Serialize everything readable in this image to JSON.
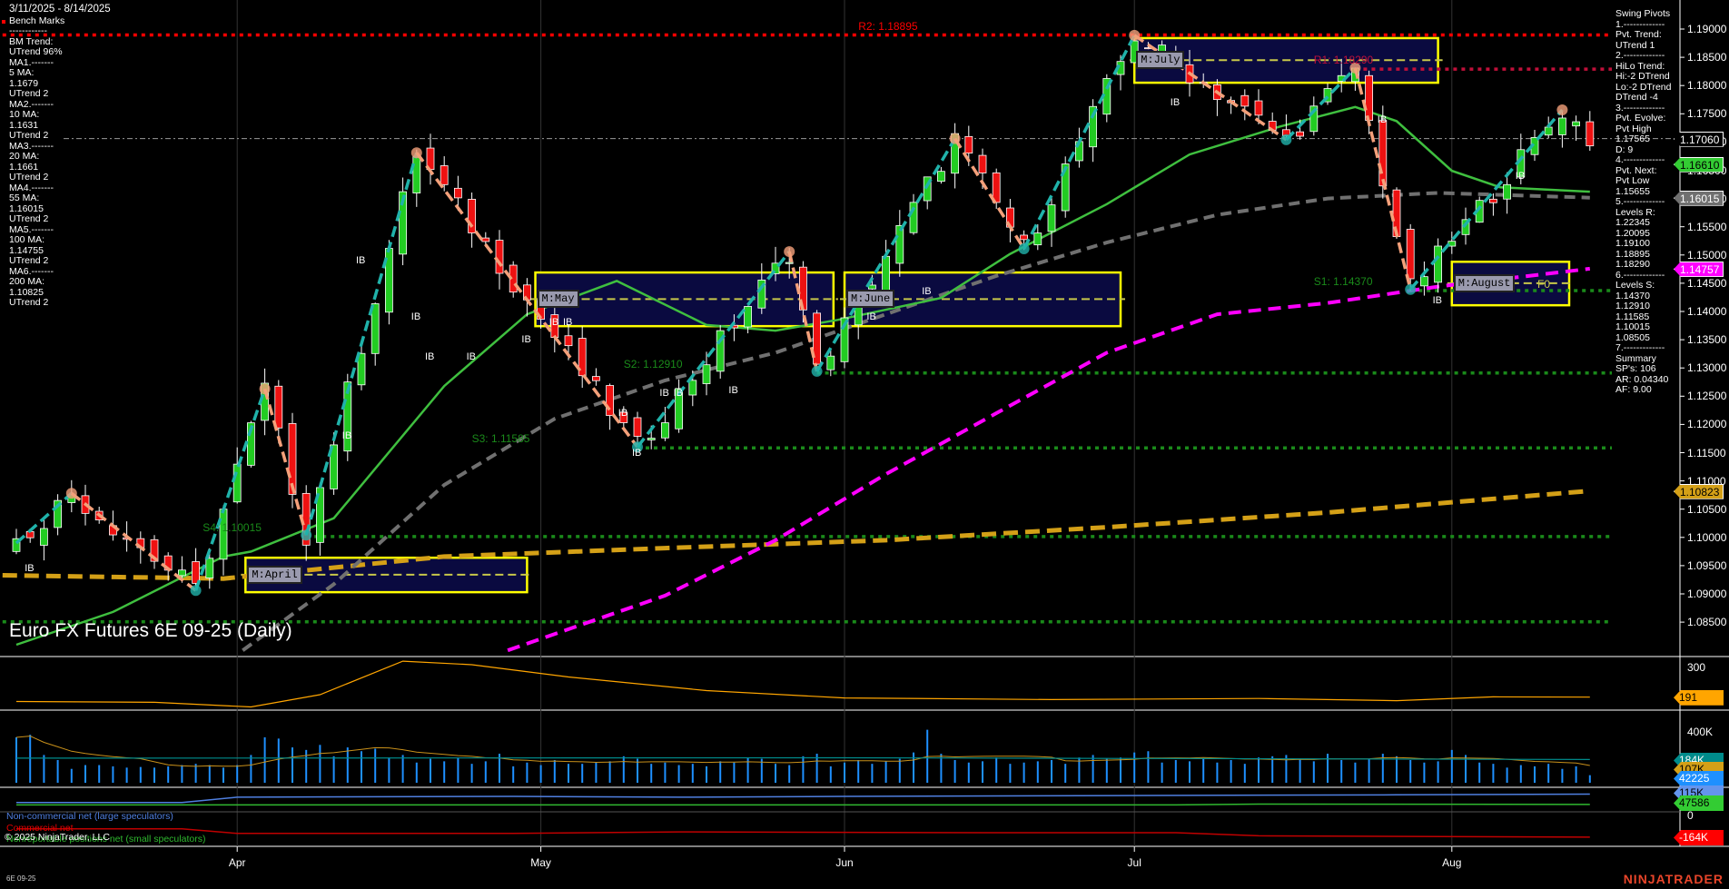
{
  "header": {
    "date_range": "3/11/2025 - 8/14/2025",
    "bench_marks": "Bench Marks"
  },
  "left_panel": [
    "------------",
    "BM Trend:",
    "UTrend 96%",
    "MA1.-------",
    "5 MA:",
    "1.1679",
    "UTrend 2",
    "MA2.-------",
    "10 MA:",
    "1.1631",
    "UTrend 2",
    "MA3.-------",
    "20 MA:",
    "1.1661",
    "UTrend 2",
    "MA4.-------",
    "55 MA:",
    "1.16015",
    "UTrend 2",
    "MA5.-------",
    "100 MA:",
    "1.14755",
    "UTrend 2",
    "MA6.-------",
    "200 MA:",
    "1.10825",
    "UTrend 2"
  ],
  "right_panel": [
    "Swing Pivots",
    "1.-------------",
    "Pvt. Trend:",
    "UTrend 1",
    "2.-------------",
    "HiLo Trend:",
    "Hi:-2 DTrend",
    "Lo:-2 DTrend",
    "DTrend -4",
    "3.-------------",
    "Pvt. Evolve:",
    "Pvt High",
    "1.17565",
    "D: 9",
    "4.-------------",
    "Pvt. Next:",
    "Pvt Low",
    "1.15655",
    "5.-------------",
    "Levels R:",
    "1.22345",
    "1.20095",
    "1.19100",
    "1.18895",
    "1.18290",
    "6.-------------",
    "Levels S:",
    "1.14370",
    "1.12910",
    "1.11585",
    "1.10015",
    "1.08505",
    "7.-------------",
    "Summary",
    "SP's: 106",
    "AR: 0.04340",
    "AF: 9.00"
  ],
  "title": "Euro FX Futures 6E 09-25 (Daily)",
  "symbol": "6E 09-25",
  "copyright": "© 2025 NinjaTrader, LLC",
  "brand": "NINJATRADER",
  "legend": [
    {
      "text": "Non-commercial net (large speculators)",
      "color": "#4f7fe0"
    },
    {
      "text": "Commercial net",
      "color": "#e00000"
    },
    {
      "text": "Nonreportable positions net (small speculators)",
      "color": "#2fb82f"
    }
  ],
  "chart_data": {
    "type": "candlestick",
    "title": "Euro FX Futures 6E 09-25 (Daily)",
    "ylim": [
      1.08,
      1.1925
    ],
    "y_ticks": [
      "1.19000",
      "1.18500",
      "1.18000",
      "1.17500",
      "1.17000",
      "1.16500",
      "1.16000",
      "1.15500",
      "1.15000",
      "1.14500",
      "1.14000",
      "1.13500",
      "1.13000",
      "1.12500",
      "1.12000",
      "1.11500",
      "1.11000",
      "1.10500",
      "1.10000",
      "1.09500",
      "1.09000",
      "1.08500"
    ],
    "bars": 115,
    "months": [
      {
        "label": "Apr",
        "bar": 16
      },
      {
        "label": "May",
        "bar": 38
      },
      {
        "label": "Jun",
        "bar": 60
      },
      {
        "label": "Jul",
        "bar": 81
      },
      {
        "label": "Aug",
        "bar": 104
      }
    ],
    "swing_pivots": [
      [
        0,
        1.099
      ],
      [
        4,
        1.1078
      ],
      [
        13,
        1.0906
      ],
      [
        18,
        1.1263
      ],
      [
        21,
        1.1004
      ],
      [
        29,
        1.1681
      ],
      [
        45,
        1.116
      ],
      [
        56,
        1.1506
      ],
      [
        58,
        1.1294
      ],
      [
        68,
        1.1706
      ],
      [
        73,
        1.1511
      ],
      [
        81,
        1.1889
      ],
      [
        92,
        1.1704
      ],
      [
        97,
        1.1831
      ],
      [
        101,
        1.1439
      ],
      [
        112,
        1.1757
      ],
      [
        114,
        1.1706
      ]
    ],
    "ma20": [
      [
        0,
        1.081
      ],
      [
        7,
        1.0868
      ],
      [
        15,
        1.0966
      ],
      [
        17,
        1.0975
      ],
      [
        23,
        1.1034
      ],
      [
        31,
        1.1268
      ],
      [
        37,
        1.1395
      ],
      [
        43.5,
        1.1454
      ],
      [
        50,
        1.1376
      ],
      [
        55,
        1.1366
      ],
      [
        59.5,
        1.1385
      ],
      [
        67,
        1.1424
      ],
      [
        72,
        1.1502
      ],
      [
        79,
        1.159
      ],
      [
        85,
        1.1678
      ],
      [
        91.5,
        1.1727
      ],
      [
        97,
        1.1762
      ],
      [
        100,
        1.1737
      ],
      [
        104,
        1.1649
      ],
      [
        107.5,
        1.162
      ],
      [
        114,
        1.1612
      ]
    ],
    "ma55": [
      [
        16.4,
        1.08
      ],
      [
        23,
        1.0917
      ],
      [
        31,
        1.1093
      ],
      [
        39,
        1.121
      ],
      [
        47,
        1.1278
      ],
      [
        55,
        1.1327
      ],
      [
        63,
        1.1395
      ],
      [
        71,
        1.1463
      ],
      [
        79,
        1.1522
      ],
      [
        87,
        1.1571
      ],
      [
        95,
        1.16
      ],
      [
        103,
        1.161
      ],
      [
        114,
        1.16015
      ]
    ],
    "ma100": [
      [
        35.6,
        1.08
      ],
      [
        47,
        1.0897
      ],
      [
        55,
        1.0995
      ],
      [
        63,
        1.1112
      ],
      [
        71,
        1.122
      ],
      [
        79,
        1.1327
      ],
      [
        87,
        1.1395
      ],
      [
        95,
        1.1415
      ],
      [
        103,
        1.1444
      ],
      [
        114,
        1.14757
      ]
    ],
    "ma200": [
      [
        -1,
        1.0933
      ],
      [
        15,
        1.0927
      ],
      [
        31,
        1.0966
      ],
      [
        47,
        1.0981
      ],
      [
        63,
        1.0995
      ],
      [
        79,
        1.1018
      ],
      [
        95,
        1.1044
      ],
      [
        114,
        1.10823
      ]
    ],
    "levels": [
      {
        "label": "R2: 1.18895",
        "value": 1.18895,
        "from_bar": -1,
        "color": "#ff0000",
        "label_bar": 61
      },
      {
        "label": "R1: 1.18290",
        "value": 1.1829,
        "from_bar": 97,
        "color": "#c0103a",
        "label_bar": 94
      },
      {
        "label": "S1: 1.14370",
        "value": 1.1437,
        "from_bar": 101,
        "color": "#1a8a1a",
        "label_bar": 94
      },
      {
        "label": "S2: 1.12910",
        "value": 1.1291,
        "from_bar": 58,
        "color": "#1a8a1a",
        "label_bar": 44
      },
      {
        "label": "S3: 1.11585",
        "value": 1.11585,
        "from_bar": 45,
        "color": "#1a8a1a",
        "label_bar": 33
      },
      {
        "label": "S4: 1.10015",
        "value": 1.10015,
        "from_bar": 21,
        "color": "#1a8a1a",
        "label_bar": 13.5
      },
      {
        "label": "",
        "value": 1.08505,
        "from_bar": -1,
        "color": "#1a8a1a",
        "label_bar": 0
      }
    ],
    "last_price": 1.1706,
    "price_tags": [
      {
        "value": "1.17060",
        "bg": "#000000",
        "fg": "#ffffff"
      },
      {
        "value": "1.16610",
        "bg": "#33cc33",
        "fg": "#000000"
      },
      {
        "value": "1.16015",
        "bg": "#707070",
        "fg": "#ffffff"
      },
      {
        "value": "1.14757",
        "bg": "#ff00ff",
        "fg": "#ffffff"
      },
      {
        "value": "1.10823",
        "bg": "#d4a017",
        "fg": "#000000"
      }
    ],
    "month_boxes": [
      {
        "label": "M:April",
        "from_bar": 16.6,
        "to_bar": 37,
        "high": 1.0964,
        "low": 1.0903,
        "mid": 1.0934
      },
      {
        "label": "M:May",
        "from_bar": 37.6,
        "to_bar": 59.2,
        "high": 1.1469,
        "low": 1.1374,
        "mid": 1.1422
      },
      {
        "label": "M:June",
        "from_bar": 60,
        "to_bar": 80,
        "high": 1.1469,
        "low": 1.1374,
        "mid": 1.1422
      },
      {
        "label": "M:July",
        "from_bar": 81,
        "to_bar": 103,
        "high": 1.1884,
        "low": 1.1805,
        "mid": 1.1845
      },
      {
        "label": "M:August",
        "from_bar": 104,
        "to_bar": 112.5,
        "high": 1.1488,
        "low": 1.1411,
        "mid": 1.145,
        "extra": "F0"
      }
    ],
    "ib_markers": [
      [
        1,
        1.0945
      ],
      [
        24,
        1.118
      ],
      [
        25,
        1.149
      ],
      [
        29,
        1.139
      ],
      [
        30,
        1.132
      ],
      [
        33,
        1.132
      ],
      [
        37,
        1.135
      ],
      [
        39,
        1.138
      ],
      [
        40,
        1.138
      ],
      [
        44,
        1.122
      ],
      [
        45,
        1.115
      ],
      [
        47,
        1.1255
      ],
      [
        48,
        1.1255
      ],
      [
        52,
        1.126
      ],
      [
        62,
        1.139
      ],
      [
        66,
        1.1435
      ],
      [
        84,
        1.177
      ],
      [
        99,
        1.174
      ],
      [
        103,
        1.142
      ],
      [
        109,
        1.164
      ]
    ],
    "ib_label": "IB",
    "indicator": {
      "ticks": [
        "300"
      ],
      "last": "191",
      "color": "#ffa500",
      "points": [
        [
          0,
          175
        ],
        [
          10,
          172
        ],
        [
          17,
          155
        ],
        [
          22,
          200
        ],
        [
          28,
          323
        ],
        [
          33,
          310
        ],
        [
          40,
          265
        ],
        [
          50,
          215
        ],
        [
          60,
          188
        ],
        [
          75,
          182
        ],
        [
          90,
          186
        ],
        [
          100,
          178
        ],
        [
          107,
          192
        ],
        [
          114,
          191
        ]
      ]
    },
    "volume": {
      "ticks": [
        "400K"
      ],
      "tags": [
        {
          "value": "184K",
          "bg": "#008b8b",
          "fg": "#fff"
        },
        {
          "value": "107K",
          "bg": "#d4a017",
          "fg": "#000"
        },
        {
          "value": "42225",
          "bg": "#1e90ff",
          "fg": "#fff"
        }
      ],
      "values_k": [
        360,
        380,
        220,
        180,
        110,
        140,
        140,
        130,
        120,
        125,
        120,
        130,
        140,
        150,
        140,
        120,
        140,
        220,
        360,
        350,
        280,
        260,
        300,
        210,
        280,
        250,
        270,
        200,
        220,
        160,
        190,
        170,
        200,
        150,
        170,
        230,
        130,
        160,
        140,
        180,
        150,
        150,
        160,
        170,
        210,
        190,
        150,
        160,
        140,
        150,
        130,
        170,
        160,
        200,
        190,
        150,
        140,
        210,
        230,
        130,
        160,
        180,
        150,
        170,
        190,
        240,
        420,
        230,
        180,
        160,
        170,
        200,
        150,
        160,
        170,
        180,
        150,
        200,
        220,
        190,
        200,
        240,
        250,
        160,
        180,
        170,
        190,
        160,
        180,
        150,
        200,
        210,
        220,
        190,
        170,
        230,
        180,
        160,
        190,
        230,
        210,
        180,
        160,
        170,
        260,
        220,
        160,
        150,
        120,
        140,
        130,
        150,
        110,
        130,
        60
      ]
    },
    "cot": {
      "ticks": [
        "0"
      ],
      "tags": [
        {
          "value": "115K",
          "bg": "#6495ed",
          "fg": "#000"
        },
        {
          "value": "47586",
          "bg": "#33cc33",
          "fg": "#000"
        },
        {
          "value": "-164K",
          "bg": "#ff0000",
          "fg": "#fff"
        }
      ],
      "noncommercial": [
        [
          0,
          60
        ],
        [
          12,
          60
        ],
        [
          16,
          95
        ],
        [
          36,
          100
        ],
        [
          48,
          95
        ],
        [
          60,
          100
        ],
        [
          80,
          105
        ],
        [
          100,
          110
        ],
        [
          114,
          115
        ]
      ],
      "commercial": [
        [
          0,
          -110
        ],
        [
          12,
          -110
        ],
        [
          16,
          -140
        ],
        [
          36,
          -140
        ],
        [
          48,
          -130
        ],
        [
          70,
          -135
        ],
        [
          84,
          -135
        ],
        [
          90,
          -155
        ],
        [
          114,
          -164
        ]
      ],
      "nonreportable": [
        [
          0,
          45
        ],
        [
          84,
          45
        ],
        [
          90,
          50
        ],
        [
          114,
          47.6
        ]
      ]
    }
  }
}
